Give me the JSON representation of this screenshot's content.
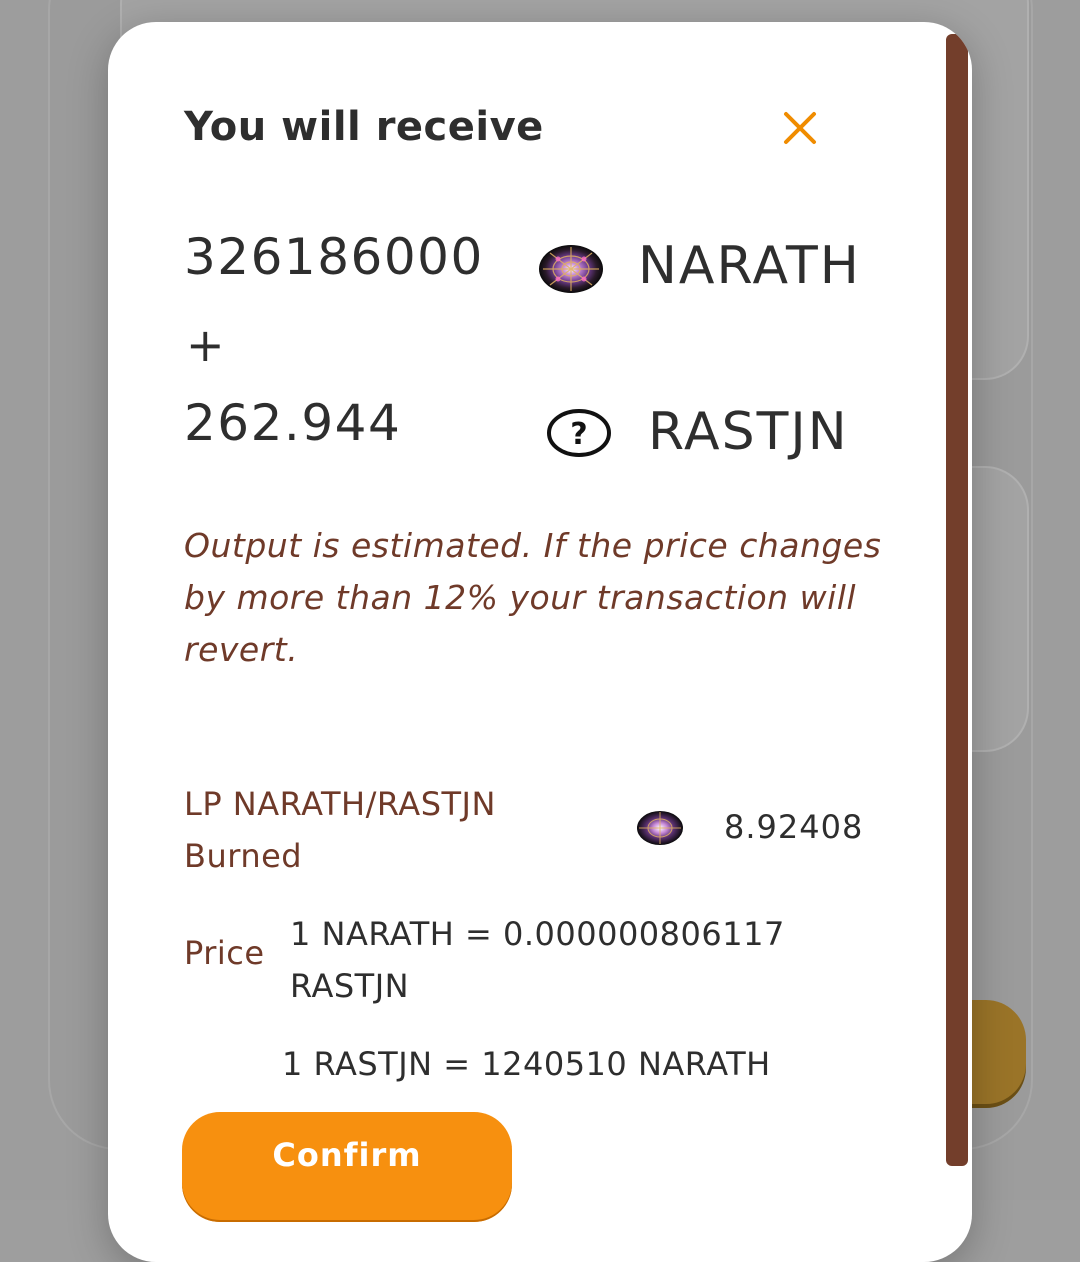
{
  "modal": {
    "title": "You will receive",
    "close_icon": "close-icon",
    "outputs": [
      {
        "amount": "326186000",
        "symbol": "NARATH",
        "icon": "kaleidoscope-token-icon"
      },
      {
        "amount": "262.944",
        "symbol": "RASTJN",
        "icon": "question-mark-token-icon"
      }
    ],
    "plus_sign": "+",
    "warning": "Output is estimated. If the price changes by more than 12% your transaction will revert.",
    "lp": {
      "label": "LP NARATH/RASTJN Burned",
      "value": "8.92408",
      "icon": "kaleidoscope-token-icon"
    },
    "price": {
      "label": "Price",
      "rate": "1 NARATH = 0.000000806117 RASTJN",
      "inverse": "1 RASTJN = 1240510 NARATH"
    },
    "confirm_label": "Confirm"
  },
  "colors": {
    "accent": "#f7900f",
    "close_icon": "#f08c00",
    "warning_text": "#6f3a29",
    "scrollbar": "#733e2b"
  }
}
